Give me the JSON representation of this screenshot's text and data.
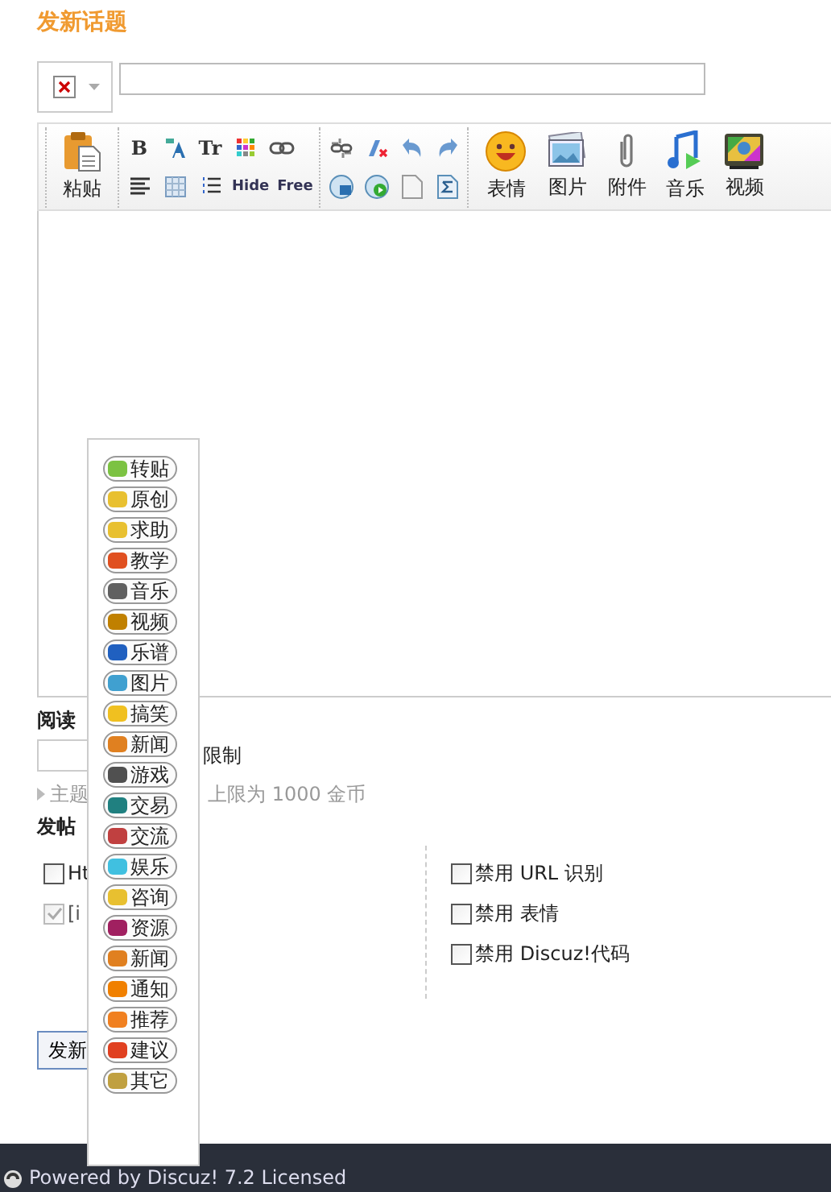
{
  "title": "发新话题",
  "toolbar": {
    "paste": "粘贴",
    "groups": [
      {
        "rows": [
          [
            {
              "kind": "text",
              "label": "B"
            },
            {
              "kind": "icon"
            },
            {
              "kind": "text",
              "label": "Tr"
            },
            {
              "kind": "icon"
            },
            {
              "kind": "icon"
            }
          ],
          [
            {
              "kind": "icon"
            },
            {
              "kind": "icon"
            },
            {
              "kind": "icon"
            },
            {
              "kind": "text",
              "label": "Hide"
            },
            {
              "kind": "text",
              "label": "Free"
            }
          ]
        ]
      },
      {
        "rows": [
          [
            {
              "kind": "icon"
            },
            {
              "kind": "icon"
            },
            {
              "kind": "icon"
            },
            {
              "kind": "icon"
            }
          ],
          [
            {
              "kind": "icon"
            },
            {
              "kind": "icon"
            },
            {
              "kind": "icon"
            },
            {
              "kind": "icon"
            }
          ]
        ]
      }
    ],
    "big_buttons": [
      {
        "label": "表情"
      },
      {
        "label": "图片"
      },
      {
        "label": "附件"
      },
      {
        "label": "音乐"
      },
      {
        "label": "视频"
      }
    ]
  },
  "read_permission": {
    "label": "阅读",
    "hint": "限制"
  },
  "reward_hint": {
    "label": "主题",
    "hint": "上限为 1000 金币"
  },
  "options": {
    "label": "发帖",
    "left": [
      {
        "label": "Ht",
        "checked": false,
        "disabled": false
      },
      {
        "label": "[i",
        "checked": true,
        "disabled": true
      }
    ],
    "right": [
      {
        "label": "禁用 URL 识别",
        "checked": false,
        "disabled": false
      },
      {
        "label": "禁用 表情",
        "checked": false,
        "disabled": false
      },
      {
        "label": "禁用 Discuz!代码",
        "checked": false,
        "disabled": false
      }
    ]
  },
  "submit": "发新",
  "footer": "Powered by Discuz! 7.2 Licensed",
  "menu": {
    "items": [
      {
        "label": "转贴",
        "color": "#7cc242"
      },
      {
        "label": "原创",
        "color": "#e8c030"
      },
      {
        "label": "求助",
        "color": "#e8c030"
      },
      {
        "label": "教学",
        "color": "#e05020"
      },
      {
        "label": "音乐",
        "color": "#606060"
      },
      {
        "label": "视频",
        "color": "#c08000"
      },
      {
        "label": "乐谱",
        "color": "#2060c0"
      },
      {
        "label": "图片",
        "color": "#40a0d0"
      },
      {
        "label": "搞笑",
        "color": "#f0c020"
      },
      {
        "label": "新闻",
        "color": "#e08020"
      },
      {
        "label": "游戏",
        "color": "#505050"
      },
      {
        "label": "交易",
        "color": "#208080"
      },
      {
        "label": "交流",
        "color": "#c04040"
      },
      {
        "label": "娱乐",
        "color": "#40c0e0"
      },
      {
        "label": "咨询",
        "color": "#e8c030"
      },
      {
        "label": "资源",
        "color": "#a02060"
      },
      {
        "label": "新闻",
        "color": "#e08020"
      },
      {
        "label": "通知",
        "color": "#f08000"
      },
      {
        "label": "推荐",
        "color": "#f08020"
      },
      {
        "label": "建议",
        "color": "#e04020"
      },
      {
        "label": "其它",
        "color": "#c0a040"
      }
    ]
  }
}
